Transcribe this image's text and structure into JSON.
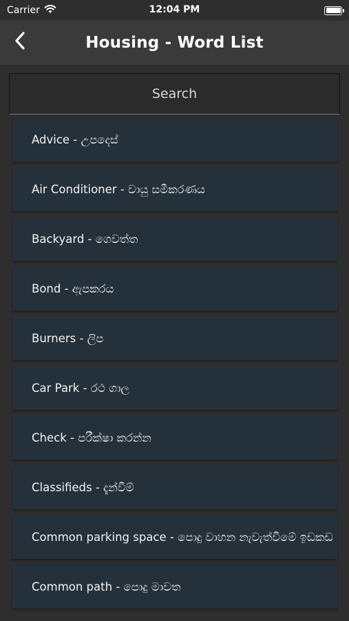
{
  "status_bar": {
    "carrier": "Carrier",
    "time": "12:04 PM"
  },
  "nav": {
    "title": "Housing - Word List"
  },
  "search": {
    "placeholder": "Search"
  },
  "words": [
    "Advice - උපදෙස්",
    "Air Conditioner - වායු සමීකරණය",
    "Backyard - ගෙවත්ත",
    "Bond - ඇපකරය",
    "Burners - ලිප",
    "Car Park - රථ ගාල",
    "Check - පරීක්ෂා කරන්න",
    "Classifieds - දැන්වීම්",
    "Common parking space - පොදු වාහන නැවැත්වීමේ ඉඩකඩ",
    "Common path - පොදු මාවත"
  ],
  "colors": {
    "background": "#2e2e2e",
    "nav_bar": "#3a3a3a",
    "list_item": "#25313a"
  }
}
